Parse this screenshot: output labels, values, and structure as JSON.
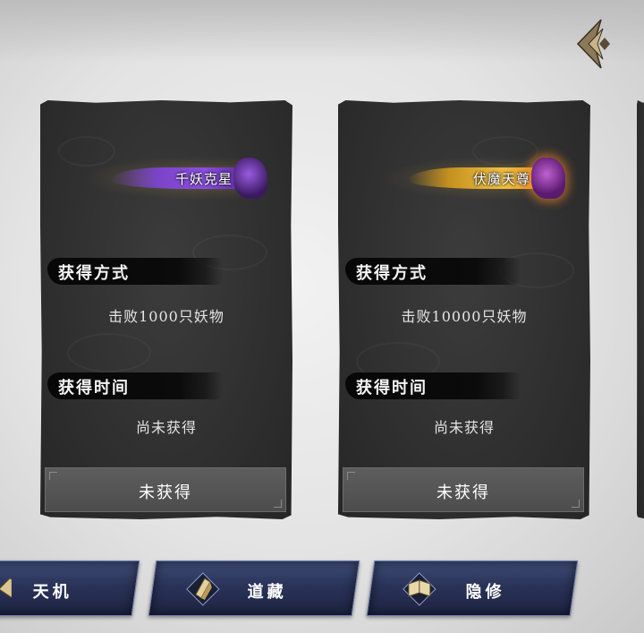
{
  "cards": [
    {
      "title": "千妖克星",
      "method_label": "获得方式",
      "method_value": "击败1000只妖物",
      "time_label": "获得时间",
      "time_value": "尚未获得",
      "status": "未获得",
      "title_color": "#8a4ee0"
    },
    {
      "title": "伏魔天尊",
      "method_label": "获得方式",
      "method_value": "击败10000只妖物",
      "time_label": "获得时间",
      "time_value": "尚未获得",
      "status": "未获得",
      "title_color": "#f0c040"
    }
  ],
  "tabs": [
    {
      "label": "天机",
      "icon": "tianji-icon"
    },
    {
      "label": "道藏",
      "icon": "scroll-icon"
    },
    {
      "label": "隐修",
      "icon": "book-icon"
    }
  ],
  "menu_icon": "diamond-menu-icon",
  "colors": {
    "card_bg": "#2f2f2f",
    "tab_bg": "#2a3358",
    "tab_border": "#6a7cb0",
    "button_bg": "#555555"
  }
}
